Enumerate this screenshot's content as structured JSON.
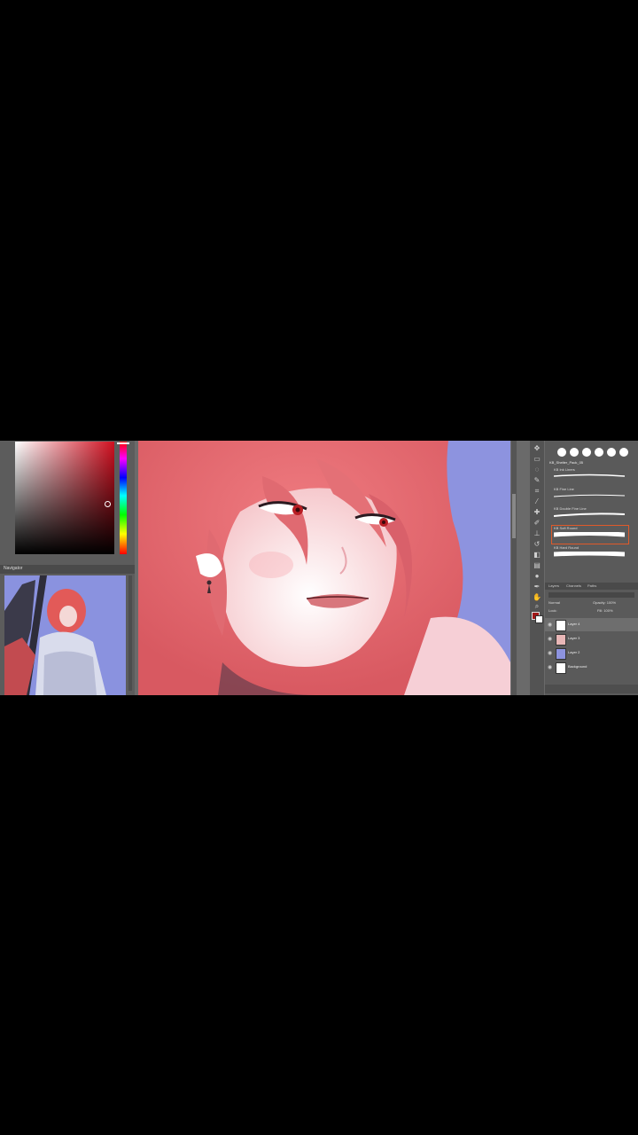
{
  "color_picker": {
    "hue": "red",
    "selected_color": "#a01818"
  },
  "navigator": {
    "title": "Navigator"
  },
  "brush_panel": {
    "folder": "KB_Shelter_Pack_05",
    "brushes": [
      {
        "name": "KB Ink Liners"
      },
      {
        "name": "KB Fine Line"
      },
      {
        "name": "KB Double Fine Line"
      },
      {
        "name": "KB Soft Round"
      },
      {
        "name": "KB Hard Round"
      }
    ],
    "selected_index": 3
  },
  "layers_panel": {
    "tabs": [
      "Layers",
      "Channels",
      "Paths"
    ],
    "blend_mode": "Normal",
    "opacity_label": "Opacity: 100%",
    "lock_label": "Lock:",
    "fill_label": "Fill: 100%",
    "layers": [
      {
        "name": "Layer 4",
        "active": true,
        "thumb_color": "#ffffff"
      },
      {
        "name": "Layer 3",
        "active": false,
        "thumb_color": "#e8b7b7"
      },
      {
        "name": "Layer 2",
        "active": false,
        "thumb_color": "#8d93df"
      },
      {
        "name": "Background",
        "active": false,
        "thumb_color": "#ffffff"
      }
    ]
  },
  "colors": {
    "canvas_bg": "#8d93df",
    "hair": "#e0676c",
    "skin": "#fbe7ea",
    "selection_accent": "#e05a2a"
  },
  "icons": [
    "eye-icon",
    "brush-icon",
    "eraser-icon",
    "move-icon",
    "lasso-icon",
    "zoom-icon"
  ]
}
